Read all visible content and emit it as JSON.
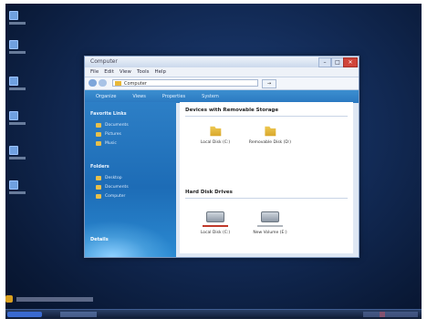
{
  "window": {
    "title": "Computer",
    "controls": {
      "minimize": "–",
      "maximize": "□",
      "close": "✕"
    }
  },
  "menu": [
    "File",
    "Edit",
    "View",
    "Tools",
    "Help"
  ],
  "address": {
    "path": "Computer",
    "go_label": "→"
  },
  "commands": [
    "Organize",
    "Views",
    "Properties",
    "System"
  ],
  "sidebar": {
    "favorites_heading": "Favorite Links",
    "favorites": [
      "Documents",
      "Pictures",
      "Music"
    ],
    "folders_heading": "Folders",
    "folders": [
      "Desktop",
      "Documents",
      "Computer"
    ],
    "details_label": "Details"
  },
  "content": {
    "folders_section": "Devices with Removable Storage",
    "folders": [
      {
        "label": "Local Disk (C:)"
      },
      {
        "label": "Removable Disk (D:)"
      }
    ],
    "drives_section": "Hard Disk Drives",
    "drives": [
      {
        "label": "Local Disk (C:)",
        "usage_bar": "red"
      },
      {
        "label": "New Volume (E:)",
        "usage_bar": "gray"
      }
    ]
  },
  "icons": {
    "folder": "folder-icon",
    "drive": "hard-drive-icon",
    "desktop": "desktop-shortcut-icon"
  }
}
